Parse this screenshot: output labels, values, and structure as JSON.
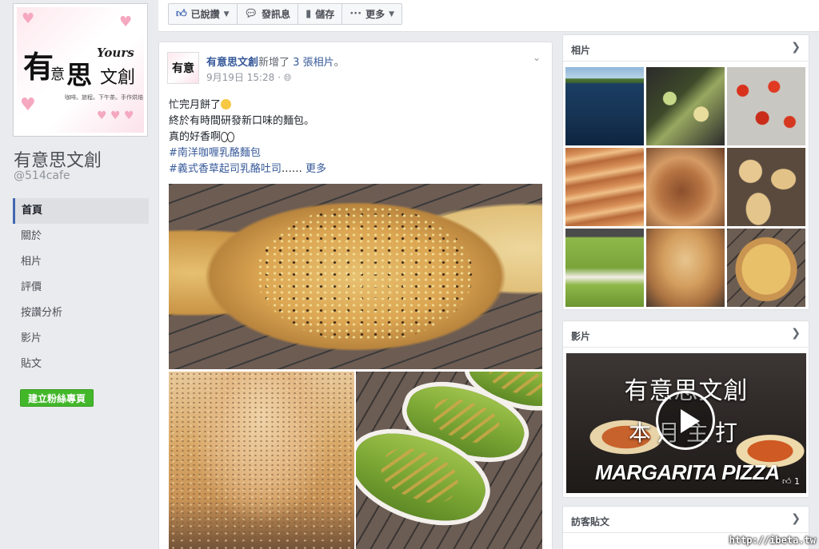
{
  "page": {
    "name": "有意思文創",
    "handle": "@514cafe",
    "logo": {
      "line1": "有",
      "line2": "意",
      "line3": "思",
      "line4": "文創",
      "brand": "Yours",
      "tagline": "咖啡。旅程。下午茶。手作烘焙"
    }
  },
  "nav": {
    "items": [
      {
        "label": "首頁",
        "active": true
      },
      {
        "label": "關於"
      },
      {
        "label": "相片"
      },
      {
        "label": "評價"
      },
      {
        "label": "按讚分析"
      },
      {
        "label": "影片"
      },
      {
        "label": "貼文"
      }
    ],
    "create_button": "建立粉絲專頁"
  },
  "action_bar": {
    "liked_label": "已說讚",
    "message_label": "發訊息",
    "save_label": "儲存",
    "more_label": "更多",
    "icons": [
      "thumbs-up-icon",
      "message-icon",
      "bookmark-icon",
      "more-icon"
    ]
  },
  "post": {
    "author": "有意思文創",
    "action_text": "新增了",
    "action_link": "3 張相片",
    "action_suffix": "。",
    "date": "9月19日 15:28",
    "privacy_sep": "·",
    "avatar_text": "有意",
    "lines": [
      "忙完月餅了",
      "終於有時間研發新口味的麵包。",
      "真的好香啊"
    ],
    "hashtags": [
      "#南洋咖喱乳酪麵包",
      "#義式香草起司乳酪吐司"
    ],
    "ellipsis": "……",
    "more_link": "更多"
  },
  "sidebar": {
    "photos_title": "相片",
    "videos_title": "影片",
    "visitor_title": "訪客貼文",
    "video": {
      "title": "有意思文創",
      "subtitle": "本月主打",
      "brand_text": "MARGARITA PIZZA",
      "likes": "1"
    }
  },
  "watermark": "http://ibeta.tw",
  "colors": {
    "link": "#365899",
    "accent": "#4267b2",
    "create_button": "#42b72a",
    "background": "#e9ebee"
  }
}
